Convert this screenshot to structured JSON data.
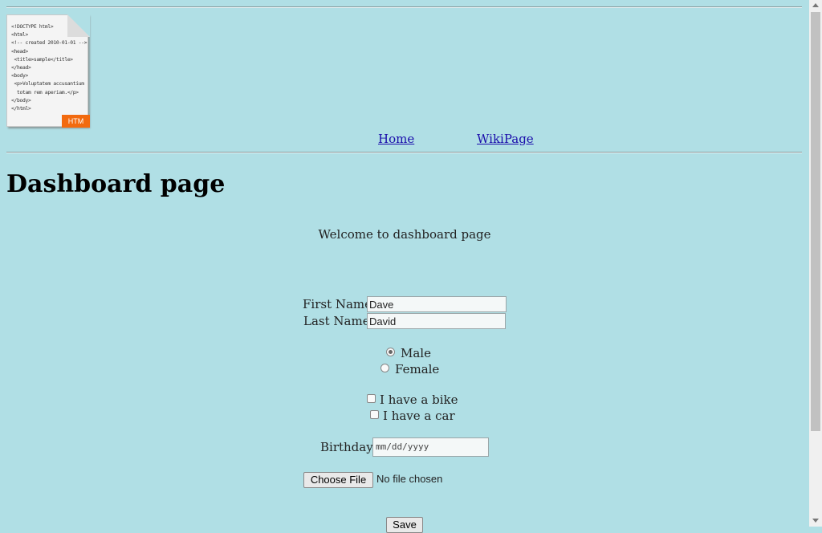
{
  "logo": {
    "code_lines": "<!DOCTYPE html>\n<html>\n<!-- created 2010-01-01 -->\n<head>\n <title>sample</title>\n</head>\n<body>\n <p>Voluptatem accusantium\n  totam rem aperiam.</p>\n</body>\n</html>",
    "tag": "HTM"
  },
  "nav": {
    "home": "Home",
    "wiki": "WikiPage"
  },
  "page": {
    "title": "Dashboard page",
    "welcome": "Welcome to dashboard page"
  },
  "form": {
    "first_name_label": "First Name:",
    "first_name_value": "Dave",
    "last_name_label": "Last Name:",
    "last_name_value": "David",
    "gender": {
      "male": "Male",
      "female": "Female",
      "selected": "Male"
    },
    "bike_label": "I have a bike",
    "car_label": "I have a car",
    "birthday_label": "Birthday:",
    "birthday_placeholder": "mm/dd/yyyy",
    "choose_file": "Choose File",
    "no_file": "No file chosen",
    "save": "Save"
  },
  "colors": {
    "background": "#b0dfe5",
    "link": "#1a0dab",
    "logo_tag": "#f26a0f"
  }
}
